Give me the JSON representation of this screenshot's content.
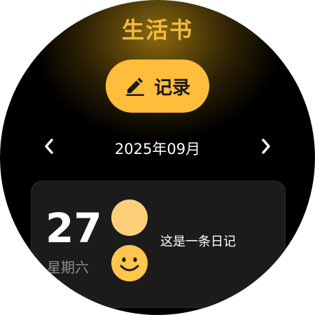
{
  "app": {
    "title": "生活书"
  },
  "record_button": {
    "label": "记录",
    "icon": "pencil-icon"
  },
  "month_nav": {
    "label": "2025年09月",
    "prev_icon": "chevron-left-icon",
    "next_icon": "chevron-right-icon"
  },
  "entry": {
    "day": "27",
    "weekday": "星期六",
    "text": "这是一条日记",
    "mood_icon": "smiley-face-icon"
  },
  "colors": {
    "accent": "#ffbd3c",
    "title": "#f4b93a",
    "card_bg": "#1b1b1b",
    "avatar": "#ffce7a"
  }
}
